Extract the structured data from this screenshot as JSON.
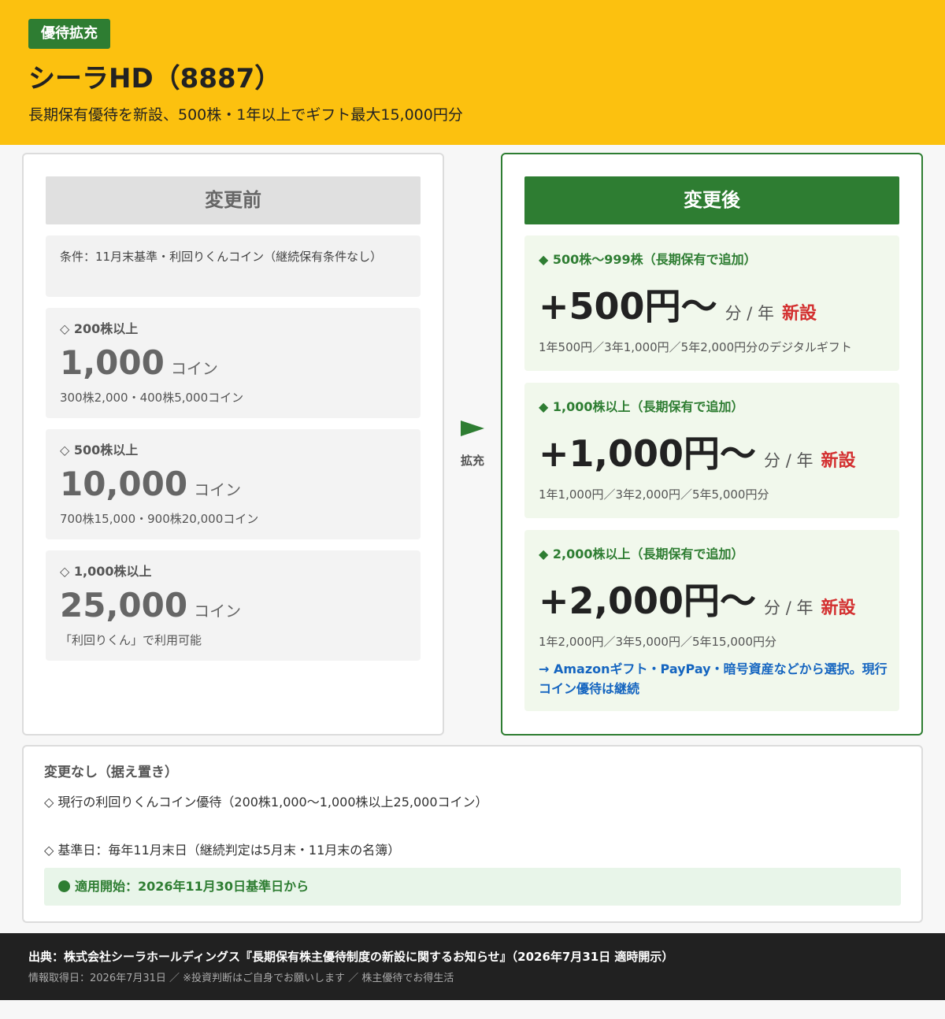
{
  "header": {
    "badge": "優待拡充",
    "title": "シーラHD（8887）",
    "subtitle": "長期保有優待を新設、500株・1年以上でギフト最大15,000円分"
  },
  "before": {
    "heading": "変更前",
    "condition": "条件：11月末基準・利回りくんコイン（継続保有条件なし）",
    "tiers": [
      {
        "title": "◇ 200株以上",
        "value": "1,000",
        "unit": "コイン",
        "note": "300株2,000・400株5,000コイン"
      },
      {
        "title": "◇ 500株以上",
        "value": "10,000",
        "unit": "コイン",
        "note": "700株15,000・900株20,000コイン"
      },
      {
        "title": "◇ 1,000株以上",
        "value": "25,000",
        "unit": "コイン",
        "note": "「利回りくん」で利用可能"
      }
    ]
  },
  "arrow": {
    "label": "拡充"
  },
  "after": {
    "heading": "変更後",
    "per_label": "分 / 年",
    "new_label": "新設",
    "tiers": [
      {
        "title": "◆ 500株～999株（長期保有で追加）",
        "value": "+500円～",
        "note": "1年500円／3年1,000円／5年2,000円分のデジタルギフト"
      },
      {
        "title": "◆ 1,000株以上（長期保有で追加）",
        "value": "+1,000円～",
        "note": "1年1,000円／3年2,000円／5年5,000円分"
      },
      {
        "title": "◆ 2,000株以上（長期保有で追加）",
        "value": "+2,000円～",
        "note": "1年2,000円／3年5,000円／5年15,000円分",
        "link": "→ Amazonギフト・PayPay・暗号資産などから選択。現行コイン優待は継続"
      }
    ]
  },
  "unchanged": {
    "title": "変更なし（据え置き）",
    "items": [
      "◇ 現行の利回りくんコイン優待（200株1,000～1,000株以上25,000コイン）",
      "◇ 基準日：毎年11月末日（継続判定は5月末・11月末の名簿）"
    ],
    "start": "適用開始：2026年11月30日基準日から"
  },
  "footer": {
    "source": "出典：株式会社シーラホールディングス『長期保有株主優待制度の新設に関するお知らせ』（2026年7月31日 適時開示）",
    "info": "情報取得日：2026年7月31日 ／ ※投資判断はご自身でお願いします ／ 株主優待でお得生活"
  },
  "colors": {
    "header_bg": "#fcc10f",
    "accent_green": "#2e7d32",
    "new_red": "#d32f2f",
    "link_blue": "#1565c0"
  }
}
